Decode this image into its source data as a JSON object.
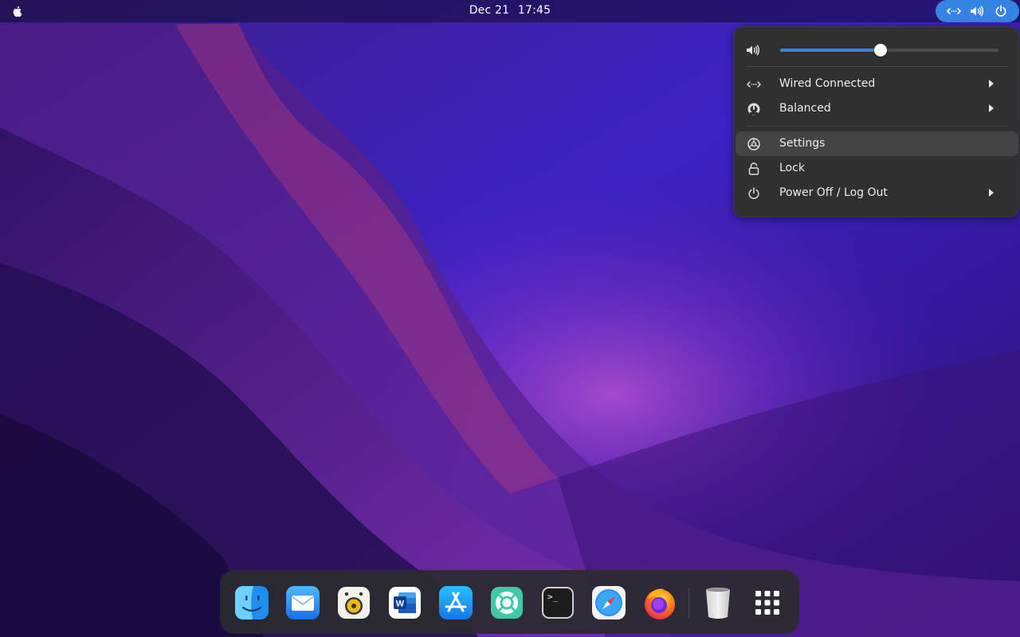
{
  "topbar": {
    "apple_icon": "apple-logo-icon",
    "clock_date": "Dec 21",
    "clock_time": "17:45",
    "status_icons": [
      "wired-network-icon",
      "volume-icon",
      "power-icon"
    ],
    "accent_color": "#3584e4"
  },
  "quick_settings": {
    "volume": {
      "icon": "volume-icon",
      "level": 0.46
    },
    "items": [
      {
        "label": "Wired Connected",
        "icon": "wired-network-icon",
        "has_submenu": true
      },
      {
        "label": "Balanced",
        "icon": "power-profile-icon",
        "has_submenu": true
      },
      {
        "label": "Settings",
        "icon": "settings-icon",
        "has_submenu": false,
        "highlighted": true
      },
      {
        "label": "Lock",
        "icon": "lock-icon",
        "has_submenu": false
      },
      {
        "label": "Power Off / Log Out",
        "icon": "power-icon",
        "has_submenu": true
      }
    ]
  },
  "dock": {
    "apps": [
      "finder-icon",
      "mail-icon",
      "rhythmbox-icon",
      "word-icon",
      "app-store-icon",
      "help-icon",
      "terminal-icon",
      "safari-icon",
      "firefox-icon"
    ],
    "trash_icon": "trash-icon",
    "app_grid_icon": "app-grid-icon",
    "word_letter": "W",
    "terminal_prompt": ">_"
  }
}
